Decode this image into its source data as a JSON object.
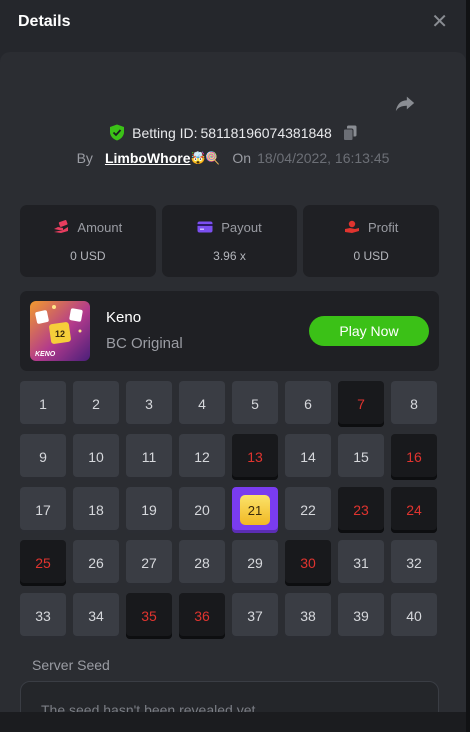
{
  "header": {
    "title": "Details",
    "close_icon": "close-icon"
  },
  "bet": {
    "betting_id_label": "Betting ID:",
    "betting_id": "58118196074381848",
    "by_label": "By",
    "username": "LimboWhore",
    "username_emoji": "🤯🍭",
    "on_label": "On",
    "date": "18/04/2022, 16:13:45"
  },
  "stats": [
    {
      "label": "Amount",
      "value": "0 USD",
      "icon": "money-hand-icon",
      "icon_color": "#e83d5f"
    },
    {
      "label": "Payout",
      "value": "3.96 x",
      "icon": "card-icon",
      "icon_color": "#7b4ff0"
    },
    {
      "label": "Profit",
      "value": "0 USD",
      "icon": "profit-hand-icon",
      "icon_color": "#e0342f"
    }
  ],
  "game": {
    "name": "Keno",
    "subtitle": "BC Original",
    "play_label": "Play Now",
    "thumb_label": "KENO",
    "thumb_number": "12"
  },
  "grid": {
    "numbers": [
      "1",
      "2",
      "3",
      "4",
      "5",
      "6",
      "7",
      "8",
      "9",
      "10",
      "11",
      "12",
      "13",
      "14",
      "15",
      "16",
      "17",
      "18",
      "19",
      "20",
      "21",
      "22",
      "23",
      "24",
      "25",
      "26",
      "27",
      "28",
      "29",
      "30",
      "31",
      "32",
      "33",
      "34",
      "35",
      "36",
      "37",
      "38",
      "39",
      "40"
    ],
    "picked": [
      7,
      13,
      16,
      23,
      24,
      25,
      30,
      35,
      36
    ],
    "hit": [
      21
    ]
  },
  "seed": {
    "label": "Server Seed",
    "placeholder": "The seed hasn't been revealed yet"
  },
  "colors": {
    "accent_green": "#3bc117",
    "picked_red": "#e0342f",
    "hit_purple": "#7a3cf0",
    "hit_gold": "#f1b824",
    "shield_green": "#3bc117"
  }
}
